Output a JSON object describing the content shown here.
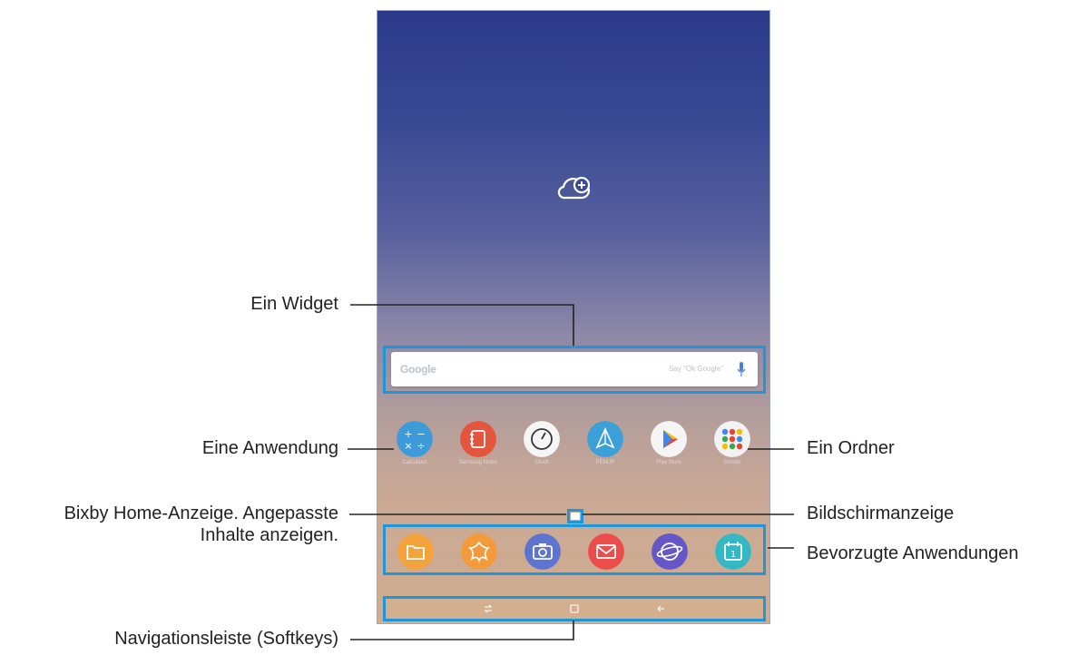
{
  "phone": {
    "search_widget": {
      "logo": "Google",
      "hint": "Say \"Ok Google\""
    },
    "apps": [
      {
        "name": "Calculator",
        "icon": "calculator-icon",
        "color": "#3e9bd9"
      },
      {
        "name": "Samsung Notes",
        "icon": "notes-icon",
        "color": "#e3553d"
      },
      {
        "name": "Clock",
        "icon": "clock-icon",
        "color": "#f5f5f5"
      },
      {
        "name": "PENUP",
        "icon": "penup-icon",
        "color": "#3b9fd8"
      },
      {
        "name": "Play Store",
        "icon": "play-store-icon",
        "color": "#f5f5f5"
      },
      {
        "name": "Google",
        "icon": "folder-icon",
        "color": "#f2f2f2"
      }
    ],
    "dock": [
      {
        "icon": "my-files-icon",
        "color": "#f3a33b"
      },
      {
        "icon": "gallery-icon",
        "color": "#f39a3c"
      },
      {
        "icon": "camera-icon",
        "color": "#5d74d1"
      },
      {
        "icon": "email-icon",
        "color": "#ed4d4a"
      },
      {
        "icon": "internet-icon",
        "color": "#6657c7"
      },
      {
        "icon": "calendar-icon",
        "color": "#34b8c4"
      }
    ],
    "navbar": [
      "recents-icon",
      "home-icon",
      "back-icon"
    ]
  },
  "callouts": {
    "widget": "Ein Widget",
    "app": "Eine Anwendung",
    "bixby_line1": "Bixby Home-Anzeige. Angepasste",
    "bixby_line2": "Inhalte anzeigen.",
    "navbar": "Navigationsleiste (Softkeys)",
    "folder": "Ein Ordner",
    "screen_indicator": "Bildschirmanzeige",
    "favorites": "Bevorzugte Anwendungen"
  },
  "colors": {
    "highlight": "#1f96d8",
    "leader_line": "#222222"
  }
}
